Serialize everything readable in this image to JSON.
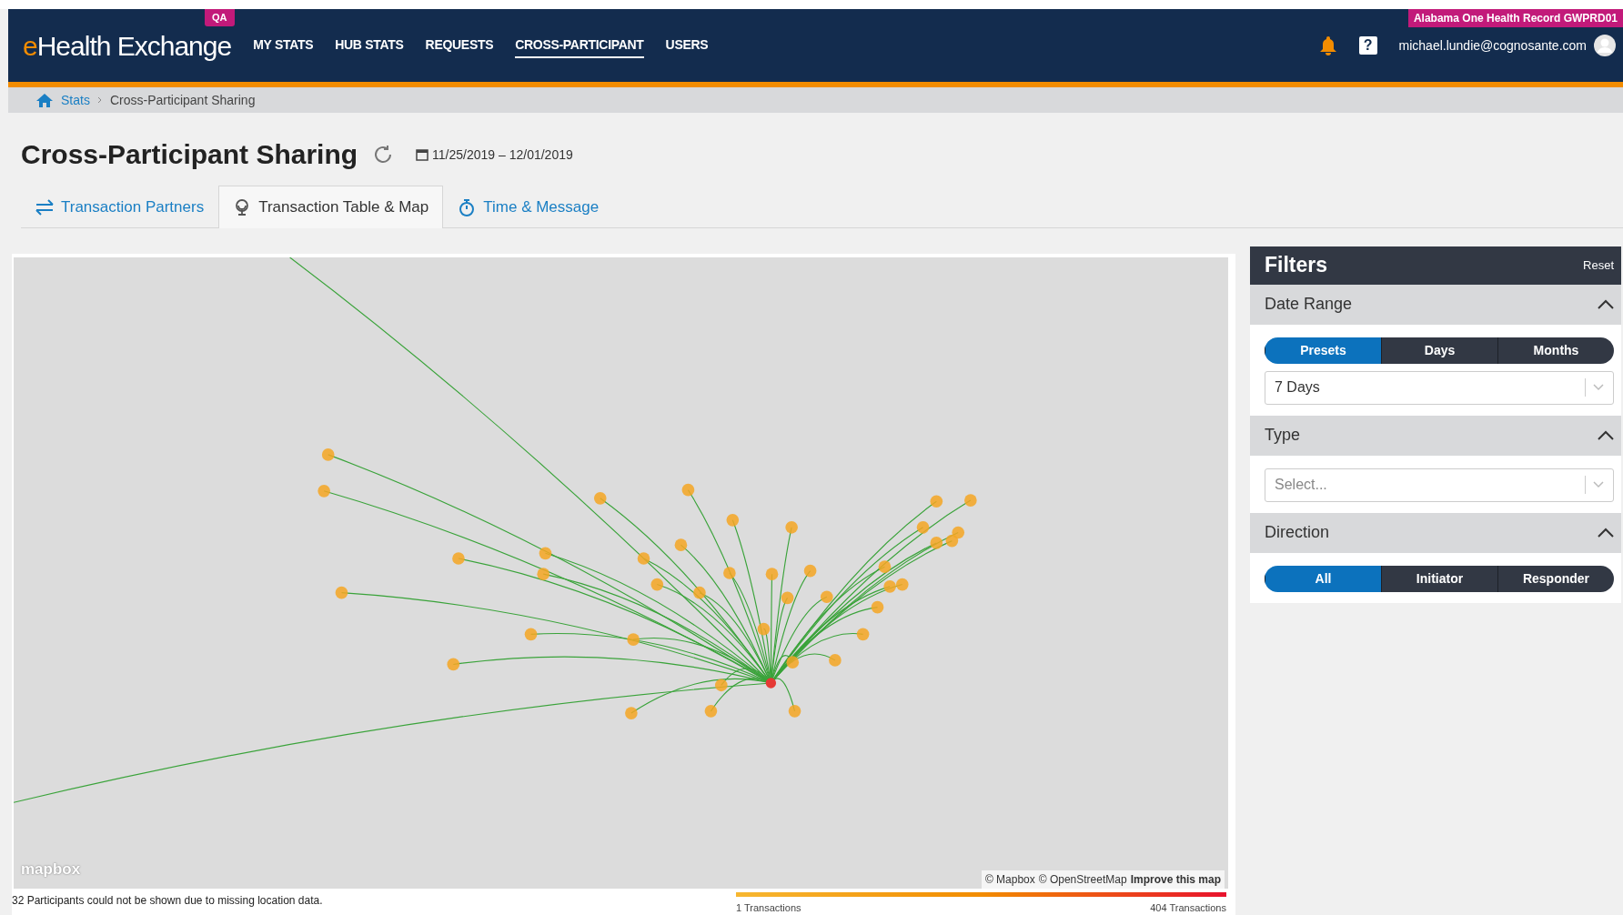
{
  "header": {
    "logo": {
      "prefix": "e",
      "name": "Health Exchange",
      "badge": "QA"
    },
    "nav": [
      {
        "label": "MY STATS",
        "selected": false
      },
      {
        "label": "HUB STATS",
        "selected": false
      },
      {
        "label": "REQUESTS",
        "selected": false
      },
      {
        "label": "CROSS-PARTICIPANT",
        "selected": true
      },
      {
        "label": "USERS",
        "selected": false
      }
    ],
    "organization": "Alabama One Health Record GWPRD01",
    "help": "?",
    "user_email": "michael.lundie@cognosante.com"
  },
  "breadcrumb": [
    "Stats",
    "Cross-Participant Sharing"
  ],
  "page": {
    "title": "Cross-Participant Sharing",
    "date_range": "11/25/2019 – 12/01/2019"
  },
  "tabs": [
    {
      "label": "Transaction Partners",
      "kind": "arrows",
      "selected": false
    },
    {
      "label": "Transaction Table & Map",
      "kind": "globe",
      "selected": true
    },
    {
      "label": "Time & Message",
      "kind": "stopwatch",
      "selected": false
    }
  ],
  "map": {
    "attribution": [
      "© Mapbox",
      "© OpenStreetMap",
      "Improve this map"
    ],
    "logo": "mapbox",
    "note": "32 Participants could not be shown due to missing location data.",
    "legend": {
      "min": "1 Transactions",
      "max": "404 Transactions"
    }
  },
  "filters": {
    "title": "Filters",
    "reset": "Reset",
    "sections": [
      {
        "title": "Date Range",
        "expanded": true,
        "segments": [
          {
            "label": "Presets",
            "selected": true
          },
          {
            "label": "Days",
            "selected": false
          },
          {
            "label": "Months",
            "selected": false
          }
        ],
        "select": {
          "value": "7 Days"
        }
      },
      {
        "title": "Type",
        "expanded": true,
        "select": {
          "placeholder": "Select..."
        }
      },
      {
        "title": "Direction",
        "expanded": true,
        "segments": [
          {
            "label": "All",
            "selected": true
          },
          {
            "label": "Initiator",
            "selected": false
          },
          {
            "label": "Responder",
            "selected": false
          }
        ]
      }
    ]
  }
}
